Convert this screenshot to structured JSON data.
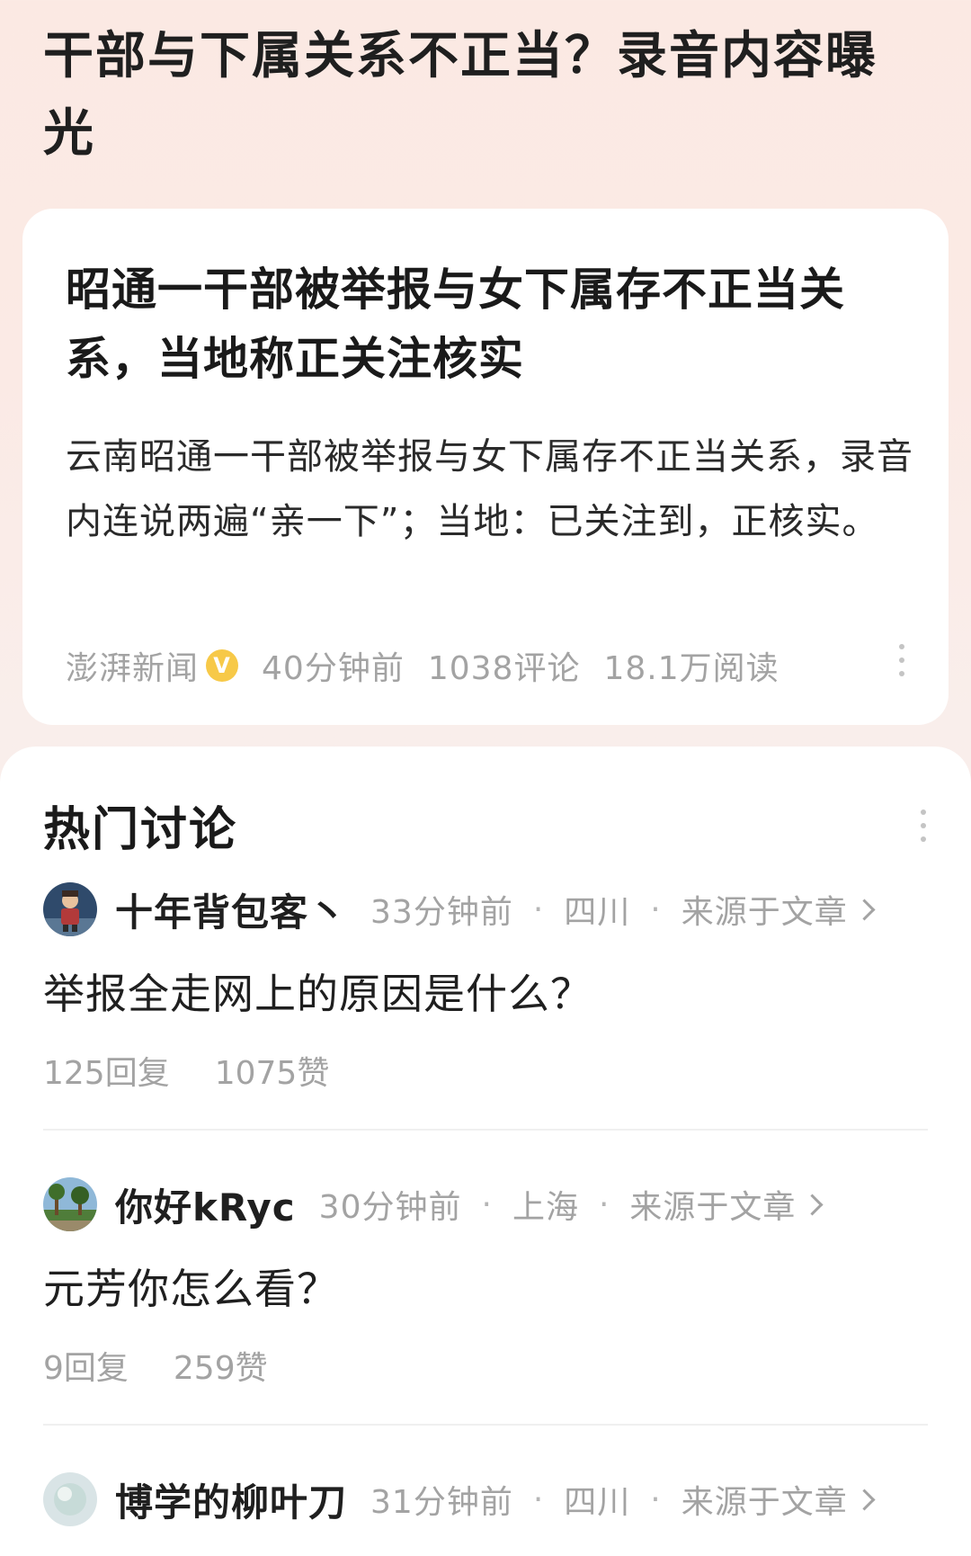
{
  "page": {
    "title": "干部与下属关系不正当？录音内容曝光"
  },
  "article": {
    "title": "昭通一干部被举报与女下属存不正当关系，当地称正关注核实",
    "summary": "云南昭通一干部被举报与女下属存不正当关系，录音内连说两遍“亲一下”；当地：已关注到，正核实。",
    "source": "澎湃新闻",
    "verified_badge": "V",
    "time": "40分钟前",
    "comments": "1038评论",
    "reads": "18.1万阅读",
    "more_icon": "more-vertical-icon"
  },
  "discussion": {
    "title": "热门讨论",
    "more_icon": "more-vertical-icon",
    "comments": [
      {
        "username": "十年背包客丶",
        "time": "33分钟前",
        "location": "四川",
        "source_link": "来源于文章",
        "text": "举报全走网上的原因是什么？",
        "replies": "125回复",
        "likes": "1075赞"
      },
      {
        "username": "你好kRyc",
        "time": "30分钟前",
        "location": "上海",
        "source_link": "来源于文章",
        "text": "元芳你怎么看？",
        "replies": "9回复",
        "likes": "259赞"
      },
      {
        "username": "博学的柳叶刀",
        "time": "31分钟前",
        "location": "四川",
        "source_link": "来源于文章"
      }
    ],
    "separator": "·"
  },
  "colors": {
    "background_top": "#fbe9e3",
    "card": "#ffffff",
    "meta_text": "#a3a3a3",
    "badge": "#f7c948"
  }
}
